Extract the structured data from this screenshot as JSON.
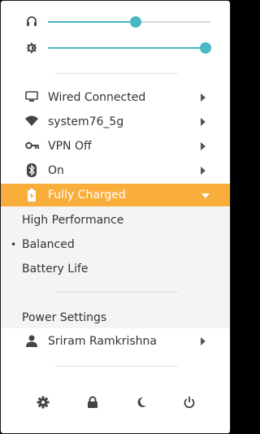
{
  "volume": {
    "icon": "headphones-icon",
    "level": 0.54
  },
  "brightness": {
    "icon": "brightness-icon",
    "level": 0.97
  },
  "rows": {
    "wired": {
      "icon": "monitor-icon",
      "label": "Wired Connected"
    },
    "wifi": {
      "icon": "wifi-icon",
      "label": "system76_5g"
    },
    "vpn": {
      "icon": "key-icon",
      "label": "VPN Off"
    },
    "bluetooth": {
      "icon": "bluetooth-icon",
      "label": "On"
    },
    "power": {
      "icon": "battery-charging-icon",
      "label": "Fully Charged"
    },
    "user": {
      "icon": "user-icon",
      "label": "Sriram Ramkrishna"
    }
  },
  "power_modes": {
    "items": [
      "High Performance",
      "Balanced",
      "Battery Life"
    ],
    "selected": "Balanced",
    "bullet": "•",
    "settings_label": "Power Settings"
  },
  "bottom_icons": [
    "settings-icon",
    "lock-icon",
    "suspend-icon",
    "power-off-icon"
  ],
  "colors": {
    "accent": "#48b9c7",
    "highlight": "#f9ad3b"
  }
}
